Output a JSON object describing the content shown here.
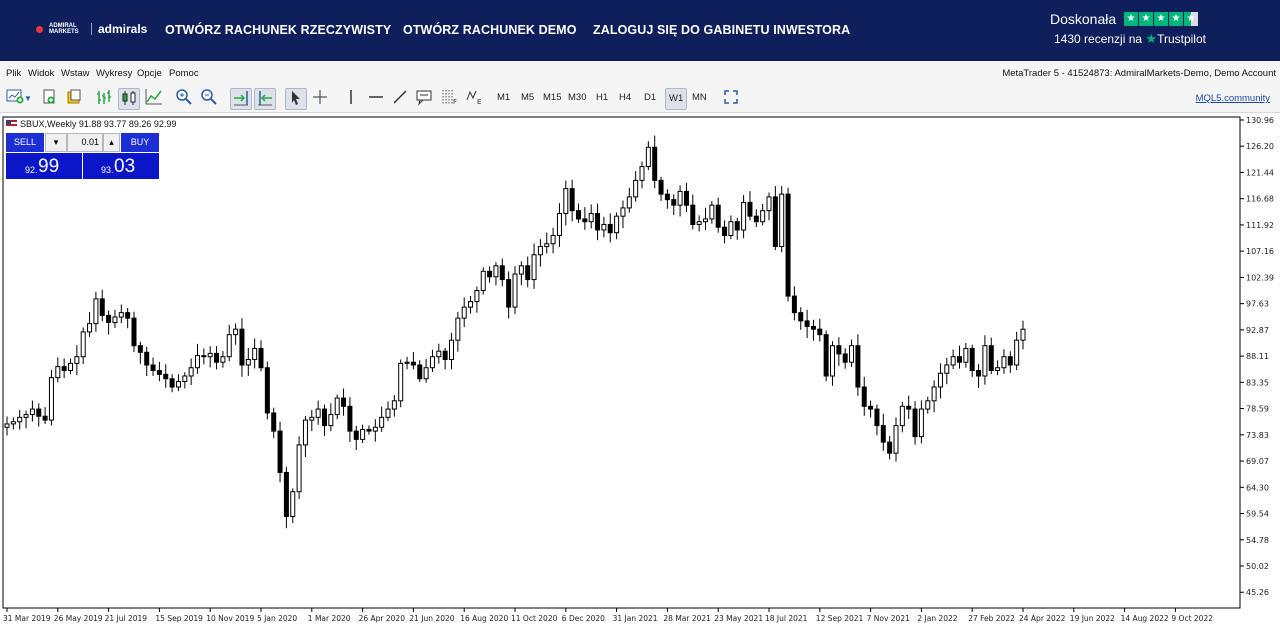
{
  "header": {
    "logo_small": "ADMIRAL MARKETS",
    "logo_name": "admirals",
    "nav": [
      "OTWÓRZ RACHUNEK RZECZYWISTY",
      "OTWÓRZ RACHUNEK DEMO",
      "ZALOGUJ SIĘ DO GABINETU INWESTORA"
    ],
    "trustpilot": {
      "rating": "Doskonała",
      "reviews": "1430 recenzji na",
      "brand": "Trustpilot"
    },
    "colors": {
      "bar": "#0f1f5c",
      "trustpilot_green": "#00b67a"
    }
  },
  "menu": {
    "items": [
      "Plik",
      "Widok",
      "Wstaw",
      "Wykresy",
      "Opcje",
      "Pomoc"
    ],
    "account": "MetaTrader 5 - 41524873: AdmiralMarkets-Demo, Demo Account"
  },
  "toolbar": {
    "icons": [
      "new-chart-icon",
      "dropdown-arrow-icon",
      "profiles-icon",
      "templates-icon",
      "bar-chart-icon",
      "candlestick-icon",
      "line-chart-icon",
      "zoom-in-icon",
      "zoom-out-icon",
      "autoscroll-icon",
      "chart-shift-icon",
      "cursor-icon",
      "crosshair-icon",
      "vertical-line-icon",
      "horizontal-line-icon",
      "trendline-icon",
      "text-icon",
      "fibonacci-icon",
      "elliott-icon"
    ],
    "timeframes": [
      "M1",
      "M5",
      "M15",
      "M30",
      "H1",
      "H4",
      "D1",
      "W1",
      "MN"
    ],
    "selected_timeframe": "W1",
    "community_link": "MQL5.community"
  },
  "chart": {
    "symbol_line": "SBUX,Weekly  91.88 93.77 89.26 92.99",
    "trade": {
      "sell_label": "SELL",
      "buy_label": "BUY",
      "lot": "0.01",
      "sell_price_small": "92.",
      "sell_price_big": "99",
      "buy_price_small": "93.",
      "buy_price_big": "03"
    }
  },
  "chart_data": {
    "type": "candlestick",
    "symbol": "SBUX",
    "timeframe": "Weekly",
    "y_ticks": [
      "130.96",
      "126.20",
      "121.44",
      "116.68",
      "111.92",
      "107.16",
      "102.39",
      "97.63",
      "92.87",
      "88.11",
      "83.35",
      "78.59",
      "73.83",
      "69.07",
      "64.30",
      "59.54",
      "54.78",
      "50.02",
      "45.26"
    ],
    "ylim": [
      42.4,
      131.5
    ],
    "x_ticks": [
      "31 Mar 2019",
      "26 May 2019",
      "21 Jul 2019",
      "15 Sep 2019",
      "10 Nov 2019",
      "5 Jan 2020",
      "1 Mar 2020",
      "26 Apr 2020",
      "21 Jun 2020",
      "16 Aug 2020",
      "11 Oct 2020",
      "6 Dec 2020",
      "31 Jan 2021",
      "28 Mar 2021",
      "23 May 2021",
      "18 Jul 2021",
      "12 Sep 2021",
      "7 Nov 2021",
      "2 Jan 2022",
      "27 Feb 2022",
      "24 Apr 2022",
      "19 Jun 2022",
      "14 Aug 2022",
      "9 Oct 2022"
    ],
    "weeks_per_tick": 8,
    "first_week": "31 Mar 2019",
    "close": [
      75.8,
      76.2,
      77.0,
      77.5,
      78.5,
      77.2,
      76.5,
      84.2,
      86.2,
      85.5,
      86.8,
      88.0,
      92.5,
      94.0,
      98.5,
      95.5,
      94.2,
      95.2,
      96.0,
      95.0,
      90.0,
      88.8,
      86.5,
      85.5,
      84.8,
      84.0,
      82.5,
      83.5,
      84.5,
      86.0,
      88.2,
      88.0,
      88.6,
      87.0,
      88.0,
      92.0,
      93.0,
      86.5,
      87.5,
      89.5,
      86.0,
      77.8,
      74.5,
      67.0,
      59.0,
      63.5,
      72.0,
      76.5,
      77.0,
      78.5,
      75.5,
      77.5,
      80.5,
      79.0,
      74.5,
      73.0,
      74.8,
      74.5,
      75.2,
      77.0,
      78.5,
      80.0,
      86.8,
      87.0,
      86.5,
      84.0,
      86.0,
      88.0,
      89.0,
      87.5,
      91.0,
      95.0,
      97.0,
      98.0,
      100.0,
      103.5,
      102.5,
      104.5,
      102.0,
      97.0,
      103.0,
      104.5,
      102.0,
      106.5,
      108.0,
      108.5,
      110.0,
      114.0,
      118.5,
      114.5,
      113.0,
      112.5,
      114.0,
      111.0,
      112.0,
      110.5,
      113.5,
      115.0,
      117.0,
      120.0,
      122.5,
      126.0,
      120.0,
      117.5,
      116.5,
      115.5,
      118.0,
      115.5,
      112.0,
      112.5,
      113.0,
      115.5,
      111.5,
      110.0,
      112.5,
      111.0,
      116.0,
      113.5,
      112.5,
      114.5,
      117.0,
      108.0,
      117.5,
      99.0,
      96.0,
      94.5,
      93.5,
      93.0,
      92.0,
      84.5,
      90.0,
      88.5,
      87.0,
      90.0,
      82.5,
      79.0,
      78.5,
      75.5,
      72.5,
      70.5,
      75.5,
      79.0,
      78.5,
      73.5,
      78.5,
      80.0,
      82.5,
      85.0,
      86.5,
      88.0,
      87.0,
      89.5,
      85.5,
      84.5,
      90.0,
      85.5,
      86.0,
      88.0,
      86.5,
      91.0,
      92.99
    ]
  }
}
